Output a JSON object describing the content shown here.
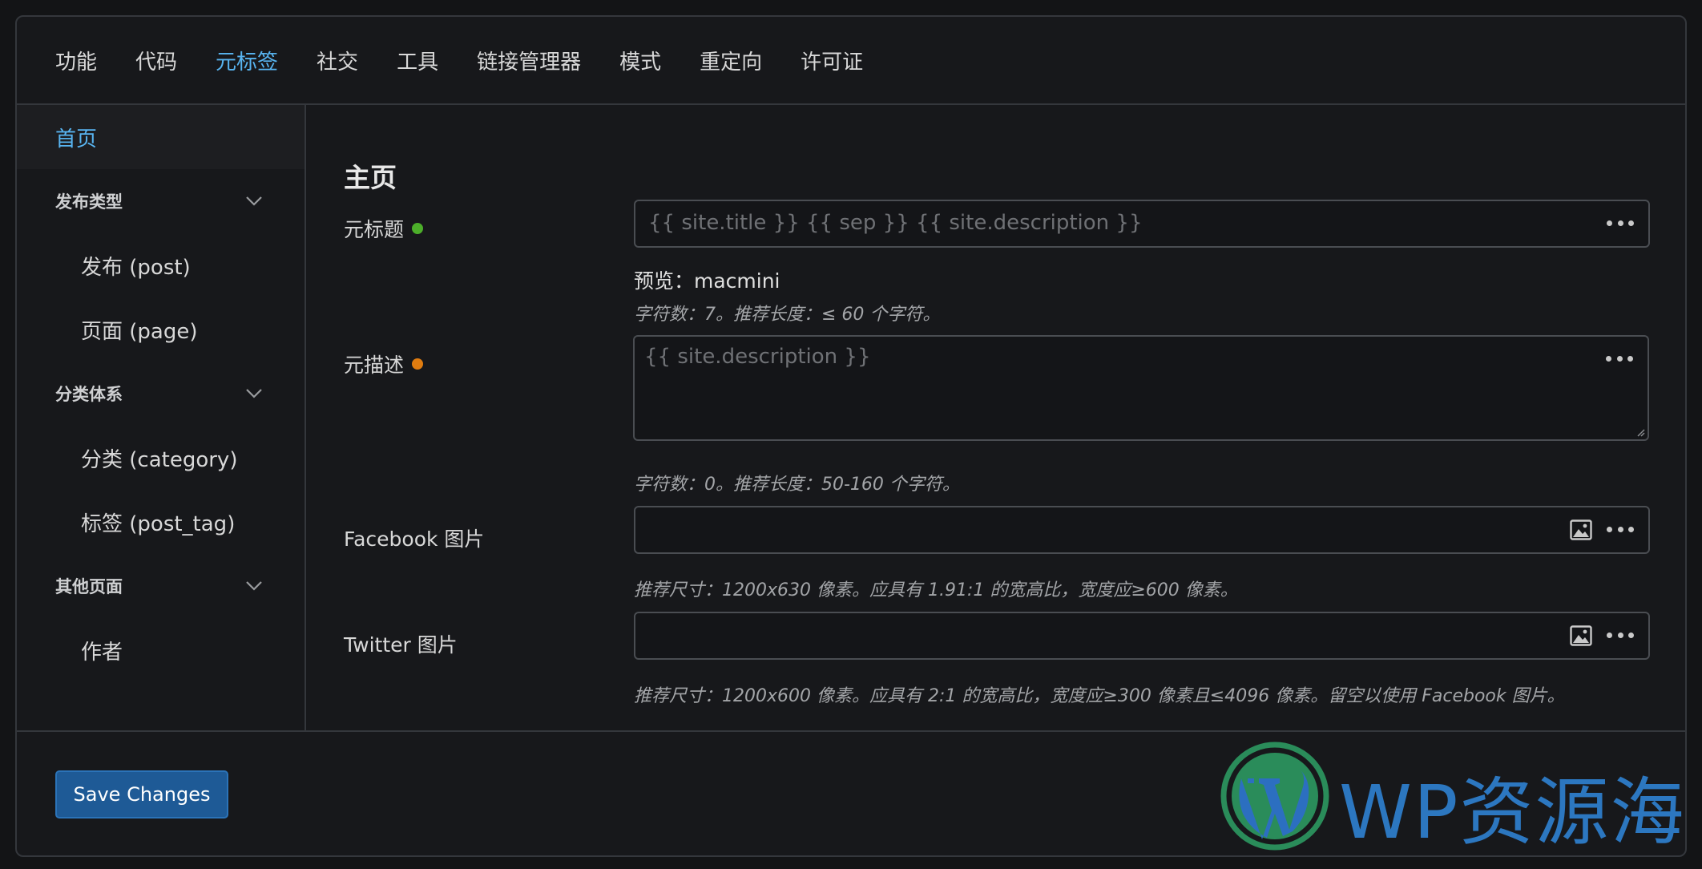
{
  "topnav": {
    "tabs": [
      {
        "label": "功能",
        "active": false
      },
      {
        "label": "代码",
        "active": false
      },
      {
        "label": "元标签",
        "active": true
      },
      {
        "label": "社交",
        "active": false
      },
      {
        "label": "工具",
        "active": false
      },
      {
        "label": "链接管理器",
        "active": false
      },
      {
        "label": "模式",
        "active": false
      },
      {
        "label": "重定向",
        "active": false
      },
      {
        "label": "许可证",
        "active": false
      }
    ]
  },
  "sidebar": {
    "home": "首页",
    "groups": [
      {
        "label": "发布类型",
        "icon": "chevron-down-icon",
        "items": [
          "发布 (post)",
          "页面 (page)"
        ]
      },
      {
        "label": "分类体系",
        "icon": "chevron-down-icon",
        "items": [
          "分类 (category)",
          "标签 (post_tag)"
        ]
      },
      {
        "label": "其他页面",
        "icon": "chevron-down-icon",
        "items": [
          "作者"
        ]
      }
    ]
  },
  "main": {
    "title": "主页",
    "meta_title": {
      "label": "元标题",
      "status_color": "#4cae2a",
      "placeholder": "{{ site.title }} {{ sep }} {{ site.description }}",
      "preview": "预览：macmini",
      "hint": "字符数：7。推荐长度：≤ 60 个字符。"
    },
    "meta_description": {
      "label": "元描述",
      "status_color": "#e07c10",
      "placeholder": "{{ site.description }}",
      "hint": "字符数：0。推荐长度：50-160 个字符。"
    },
    "facebook_image": {
      "label": "Facebook 图片",
      "hint": "推荐尺寸：1200x630 像素。应具有 1.91:1 的宽高比，宽度应≥600 像素。"
    },
    "twitter_image": {
      "label": "Twitter 图片",
      "hint": "推荐尺寸：1200x600 像素。应具有 2:1 的宽高比，宽度应≥300 像素且≤4096 像素。留空以使用 Facebook 图片。"
    }
  },
  "footer": {
    "save_label": "Save Changes"
  },
  "watermark": {
    "text": "WP资源海"
  },
  "colors": {
    "accent": "#58b4f0",
    "button": "#1e5a96"
  }
}
